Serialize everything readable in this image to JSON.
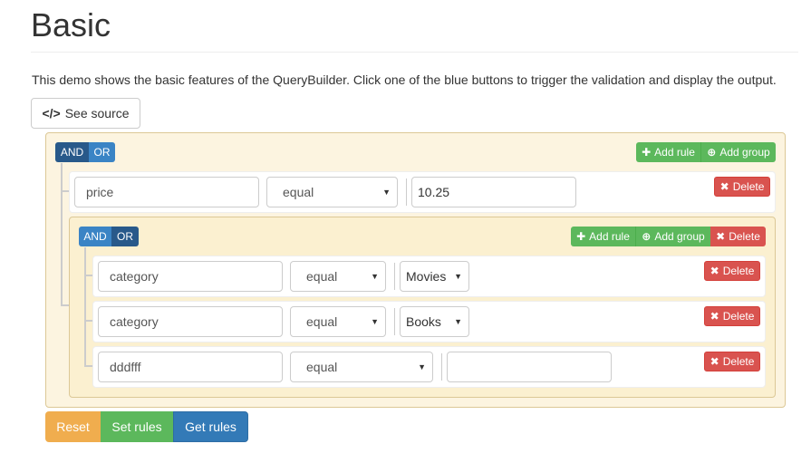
{
  "page": {
    "title": "Basic",
    "description": "This demo shows the basic features of the QueryBuilder. Click one of the blue buttons to trigger the validation and display the output.",
    "see_source_code": "</>",
    "see_source_label": "See source"
  },
  "builder": {
    "condition_and": "AND",
    "condition_or": "OR",
    "add_rule": "Add rule",
    "add_group": "Add group",
    "delete": "Delete",
    "rules": [
      {
        "field": "price",
        "operator": "equal",
        "value": "10.25"
      },
      {
        "field": "category",
        "operator": "equal",
        "value": "Movies"
      },
      {
        "field": "category",
        "operator": "equal",
        "value": "Books"
      },
      {
        "field": "dddfff",
        "operator": "equal",
        "value": ""
      }
    ]
  },
  "actions": {
    "reset": "Reset",
    "set_rules": "Set rules",
    "get_rules": "Get rules"
  },
  "colors": {
    "and_active": "#28598a",
    "or_inactive": "#3a84c5",
    "success": "#5cb85c",
    "danger": "#d9534f",
    "warning": "#f0ad4e",
    "primary": "#337ab7"
  },
  "icons": {
    "plus": "plus-icon",
    "plus_circle": "plus-circle-icon",
    "remove": "remove-icon",
    "code": "code-icon"
  }
}
